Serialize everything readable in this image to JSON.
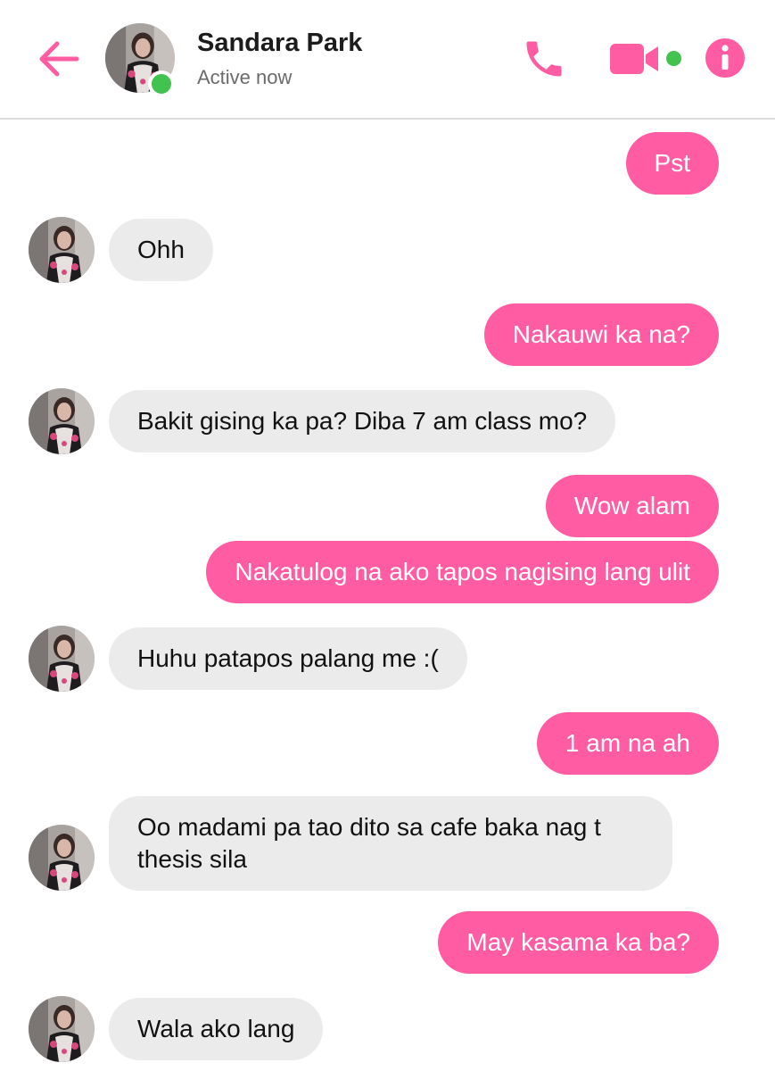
{
  "header": {
    "contact_name": "Sandara Park",
    "status": "Active now",
    "accent_color": "#ff5ca3",
    "online_color": "#42c24f",
    "icons": [
      "back-arrow-icon",
      "phone-icon",
      "video-camera-icon",
      "info-icon"
    ]
  },
  "messages": [
    {
      "sender": "me",
      "text": "Pst"
    },
    {
      "sender": "contact",
      "text": "Ohh"
    },
    {
      "sender": "me",
      "text": "Nakauwi ka na?"
    },
    {
      "sender": "contact",
      "text": "Bakit gising ka pa? Diba 7 am class mo?"
    },
    {
      "sender": "me",
      "text": "Wow alam"
    },
    {
      "sender": "me",
      "text": "Nakatulog na ako tapos nagising lang ulit"
    },
    {
      "sender": "contact",
      "text": "Huhu patapos palang me :("
    },
    {
      "sender": "me",
      "text": "1 am na ah"
    },
    {
      "sender": "contact",
      "text": "Oo madami pa tao dito sa cafe baka nag t thesis sila"
    },
    {
      "sender": "me",
      "text": "May kasama ka ba?"
    },
    {
      "sender": "contact",
      "text": "Wala ako lang"
    }
  ]
}
